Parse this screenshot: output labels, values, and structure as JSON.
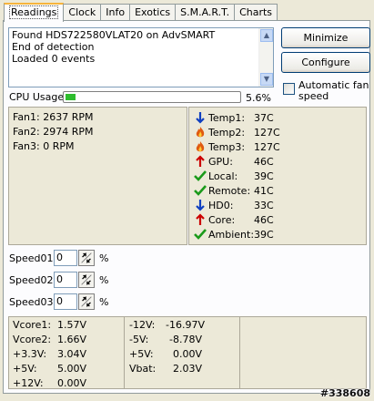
{
  "tabs": [
    {
      "label": "Readings",
      "active": true
    },
    {
      "label": "Clock"
    },
    {
      "label": "Info"
    },
    {
      "label": "Exotics"
    },
    {
      "label": "S.M.A.R.T."
    },
    {
      "label": "Charts"
    }
  ],
  "log": [
    "Found HDS722580VLAT20 on AdvSMART",
    "End of detection",
    "Loaded 0 events"
  ],
  "buttons": {
    "minimize": "Minimize",
    "configure": "Configure"
  },
  "auto_fan": {
    "label": "Automatic fan speed",
    "checked": false
  },
  "cpu": {
    "label": "CPU Usage",
    "value_text": "5.6%",
    "fraction": 0.056
  },
  "fans": [
    "Fan1: 2637 RPM",
    "Fan2: 2974 RPM",
    "Fan3: 0 RPM"
  ],
  "temps": [
    {
      "name": "Temp1:",
      "value": "37C",
      "icon": "arrow-down-icon"
    },
    {
      "name": "Temp2:",
      "value": "127C",
      "icon": "flame-icon"
    },
    {
      "name": "Temp3:",
      "value": "127C",
      "icon": "flame-icon"
    },
    {
      "name": "GPU:",
      "value": "46C",
      "icon": "arrow-up-icon"
    },
    {
      "name": "Local:",
      "value": "39C",
      "icon": "checkmark-icon"
    },
    {
      "name": "Remote:",
      "value": "41C",
      "icon": "checkmark-icon"
    },
    {
      "name": "HD0:",
      "value": "33C",
      "icon": "arrow-down-icon"
    },
    {
      "name": "Core:",
      "value": "46C",
      "icon": "arrow-up-icon"
    },
    {
      "name": "Ambient:",
      "value": "39C",
      "icon": "checkmark-icon"
    }
  ],
  "speeds": [
    {
      "label": "Speed01:",
      "value": "0",
      "unit": "%"
    },
    {
      "label": "Speed02:",
      "value": "0",
      "unit": "%"
    },
    {
      "label": "Speed03:",
      "value": "0",
      "unit": "%"
    }
  ],
  "voltages_left": [
    {
      "name": "Vcore1:",
      "value": "1.57V"
    },
    {
      "name": "Vcore2:",
      "value": "1.66V"
    },
    {
      "name": "+3.3V:",
      "value": "3.04V"
    },
    {
      "name": "+5V:",
      "value": "5.00V"
    },
    {
      "name": "+12V:",
      "value": "0.00V"
    }
  ],
  "voltages_right": [
    {
      "name": "-12V:",
      "value": "-16.97V"
    },
    {
      "name": "-5V:",
      "value": "-8.78V"
    },
    {
      "name": "+5V:",
      "value": "0.00V"
    },
    {
      "name": "Vbat:",
      "value": "2.03V"
    }
  ],
  "watermark": "#338608",
  "colors": {
    "flame": "#e05a10",
    "arrow_up": "#cc0000",
    "arrow_down": "#1040c0",
    "check": "#1a9a1a",
    "progress": "#2ebd2e"
  }
}
